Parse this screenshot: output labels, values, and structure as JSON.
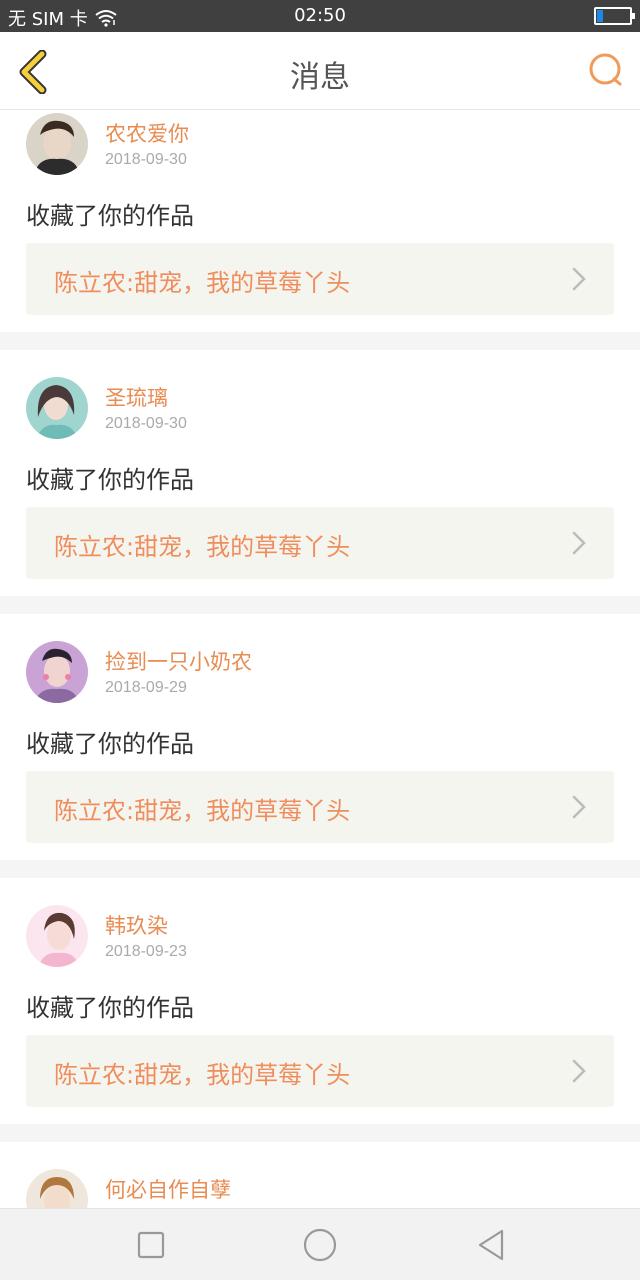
{
  "status_bar": {
    "carrier": "无 SIM 卡",
    "time": "02:50"
  },
  "header": {
    "title": "消息"
  },
  "icons": {
    "back": "chevron-left-icon",
    "search": "search-icon",
    "next": "chevron-right-icon"
  },
  "colors": {
    "accent": "#e88c52",
    "back_icon": "#f4c430"
  },
  "messages": [
    {
      "user": "农农爱你",
      "date": "2018-09-30",
      "action": "收藏了你的作品",
      "work": "陈立农:甜宠，我的草莓丫头"
    },
    {
      "user": "圣琉璃",
      "date": "2018-09-30",
      "action": "收藏了你的作品",
      "work": "陈立农:甜宠，我的草莓丫头"
    },
    {
      "user": "捡到一只小奶农",
      "date": "2018-09-29",
      "action": "收藏了你的作品",
      "work": "陈立农:甜宠，我的草莓丫头"
    },
    {
      "user": "韩玖染",
      "date": "2018-09-23",
      "action": "收藏了你的作品",
      "work": "陈立农:甜宠，我的草莓丫头"
    },
    {
      "user": "何必自作自孽"
    }
  ],
  "nav": {
    "icons": [
      "square-icon",
      "circle-icon",
      "triangle-back-icon"
    ]
  }
}
